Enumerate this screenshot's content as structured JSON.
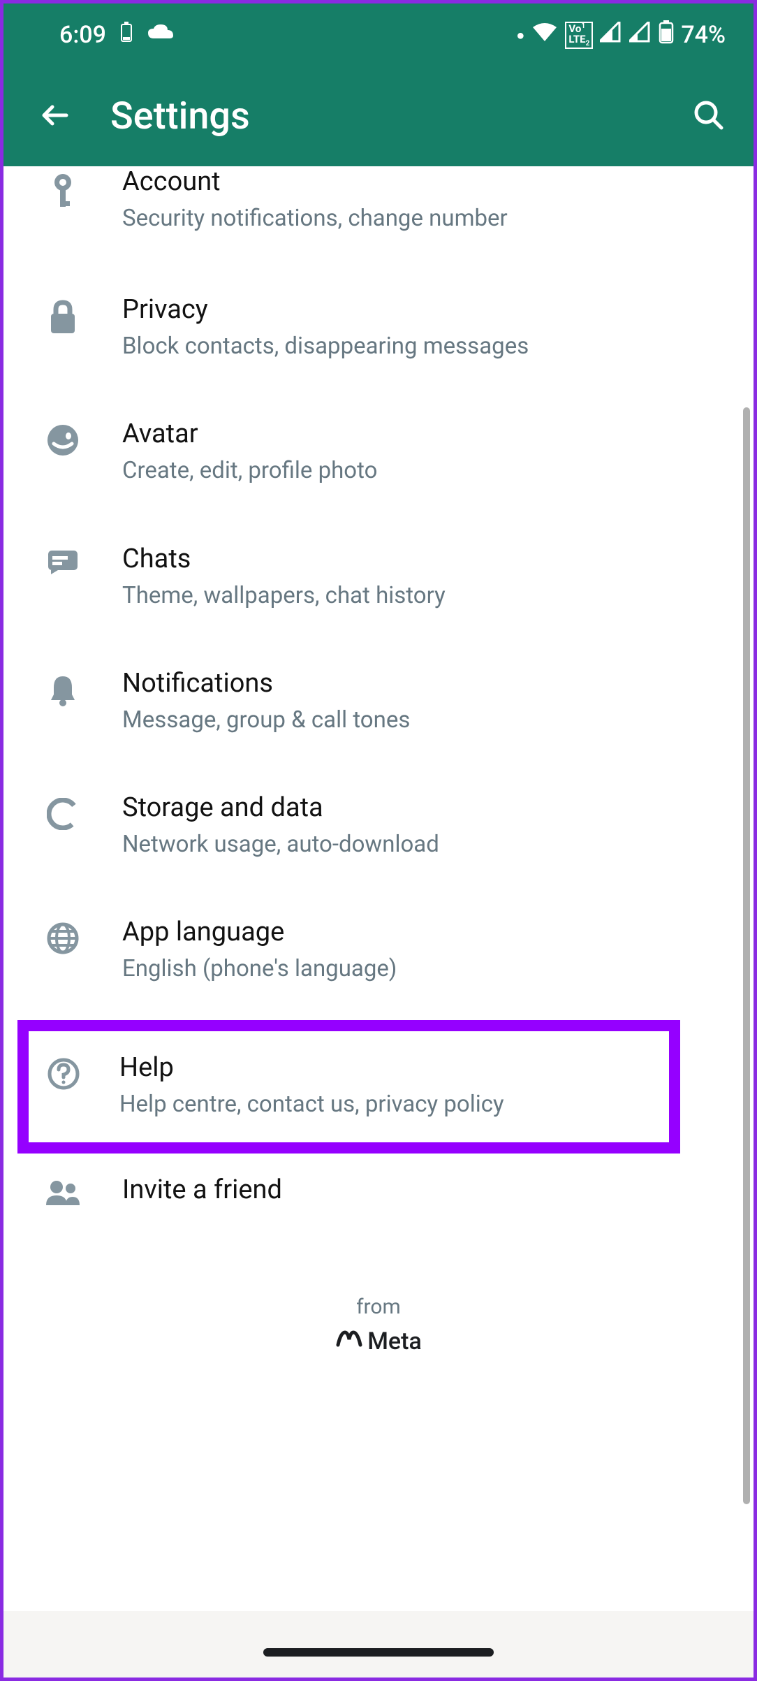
{
  "statusbar": {
    "time": "6:09",
    "battery": "74%",
    "lte_label": "LTE",
    "lte_sub": "Vo 1 2"
  },
  "header": {
    "title": "Settings"
  },
  "items": [
    {
      "title": "Account",
      "subtitle": "Security notifications, change number",
      "icon": "key"
    },
    {
      "title": "Privacy",
      "subtitle": "Block contacts, disappearing messages",
      "icon": "lock"
    },
    {
      "title": "Avatar",
      "subtitle": "Create, edit, profile photo",
      "icon": "avatar"
    },
    {
      "title": "Chats",
      "subtitle": "Theme, wallpapers, chat history",
      "icon": "chat"
    },
    {
      "title": "Notifications",
      "subtitle": "Message, group & call tones",
      "icon": "bell"
    },
    {
      "title": "Storage and data",
      "subtitle": "Network usage, auto-download",
      "icon": "data"
    },
    {
      "title": "App language",
      "subtitle": "English (phone's language)",
      "icon": "globe"
    },
    {
      "title": "Help",
      "subtitle": "Help centre, contact us, privacy policy",
      "icon": "help"
    },
    {
      "title": "Invite a friend",
      "subtitle": "",
      "icon": "people"
    }
  ],
  "footer": {
    "from": "from",
    "brand": "Meta"
  },
  "colors": {
    "primary": "#167e67",
    "highlight": "#9500ff",
    "icon": "#8596a0",
    "subtitle": "#667781"
  }
}
